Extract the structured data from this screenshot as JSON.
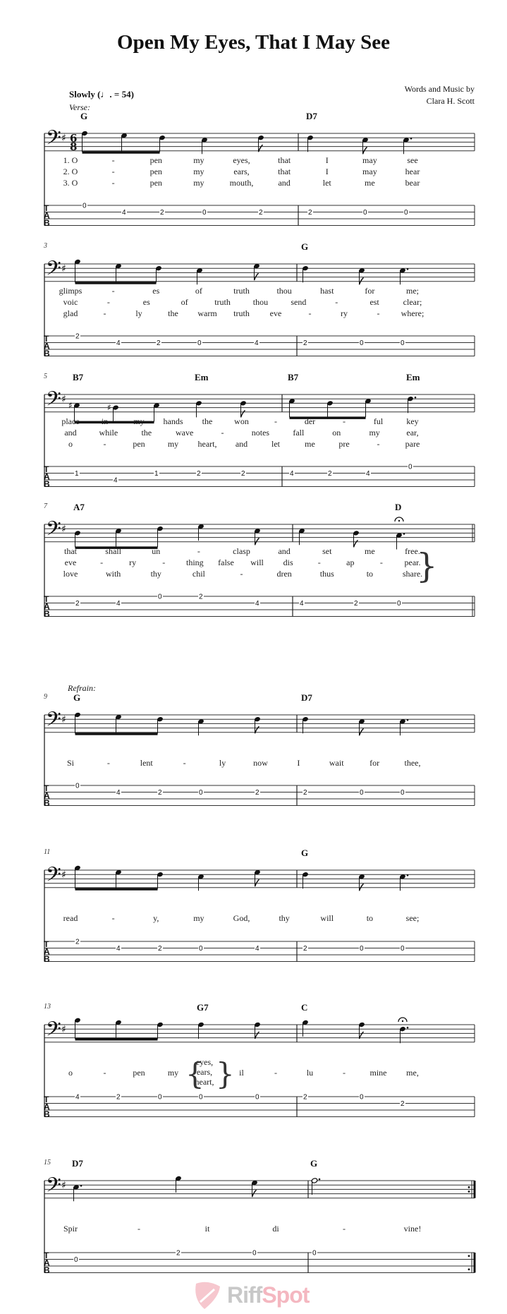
{
  "title": "Open My Eyes, That I May See",
  "tempo": {
    "text": "Slowly",
    "marking": "(♩. = 54)"
  },
  "credits": {
    "line1": "Words and Music by",
    "line2": "Clara H. Scott"
  },
  "section_labels": {
    "verse": "Verse:",
    "refrain": "Refrain:"
  },
  "time_signature": {
    "top": "6",
    "bottom": "8"
  },
  "key_signature": "G major (1 sharp)",
  "tab_label": [
    "T",
    "A",
    "B"
  ],
  "watermark": {
    "part1": "Riff",
    "part2": "Spot"
  },
  "systems": [
    {
      "measure_number": "",
      "chords": [
        {
          "label": "G",
          "beat": 0
        },
        {
          "label": "D7",
          "beat": 5
        }
      ],
      "notes": [
        {
          "p": 8,
          "dur": "8",
          "beam": "start"
        },
        {
          "p": 7,
          "dur": "8",
          "beam": "mid"
        },
        {
          "p": 6,
          "dur": "8",
          "beam": "end"
        },
        {
          "p": 5,
          "dur": "4"
        },
        {
          "p": 6,
          "dur": "8"
        },
        {
          "p": 6,
          "dur": "4",
          "bar_before": true
        },
        {
          "p": 5,
          "dur": "8"
        },
        {
          "p": 5,
          "dur": "4."
        }
      ],
      "tab": [
        {
          "s": 1,
          "f": "0"
        },
        {
          "s": 2,
          "f": "4"
        },
        {
          "s": 2,
          "f": "2"
        },
        {
          "s": 2,
          "f": "0"
        },
        {
          "s": 2,
          "f": "2"
        },
        {
          "s": 2,
          "f": "2"
        },
        {
          "s": 2,
          "f": "0"
        },
        {
          "s": 2,
          "f": "0"
        }
      ],
      "lyrics": [
        [
          "1. O",
          "-",
          "pen",
          "my",
          "eyes,",
          "that",
          "I",
          "may",
          "see"
        ],
        [
          "2. O",
          "-",
          "pen",
          "my",
          "ears,",
          "that",
          "I",
          "may",
          "hear"
        ],
        [
          "3. O",
          "-",
          "pen",
          "my",
          "mouth,",
          "and",
          "let",
          "me",
          "bear"
        ]
      ]
    },
    {
      "measure_number": "3",
      "chords": [
        {
          "label": "G",
          "beat": 5
        }
      ],
      "notes": [
        {
          "p": 9,
          "dur": "8",
          "beam": "start"
        },
        {
          "p": 7,
          "dur": "8",
          "beam": "mid"
        },
        {
          "p": 6,
          "dur": "8",
          "beam": "end"
        },
        {
          "p": 5,
          "dur": "4"
        },
        {
          "p": 7,
          "dur": "8"
        },
        {
          "p": 6,
          "dur": "4",
          "bar_before": true
        },
        {
          "p": 5,
          "dur": "8"
        },
        {
          "p": 5,
          "dur": "4."
        }
      ],
      "tab": [
        {
          "s": 1,
          "f": "2"
        },
        {
          "s": 2,
          "f": "4"
        },
        {
          "s": 2,
          "f": "2"
        },
        {
          "s": 2,
          "f": "0"
        },
        {
          "s": 2,
          "f": "4"
        },
        {
          "s": 2,
          "f": "2"
        },
        {
          "s": 2,
          "f": "0"
        },
        {
          "s": 2,
          "f": "0"
        }
      ],
      "lyrics": [
        [
          "glimps",
          "-",
          "es",
          "of",
          "truth",
          "thou",
          "hast",
          "for",
          "me;"
        ],
        [
          "voic",
          "-",
          "es",
          "of",
          "truth",
          "thou",
          "send",
          "-",
          "est",
          "clear;"
        ],
        [
          "glad",
          "-",
          "ly",
          "the",
          "warm",
          "truth",
          "eve",
          "-",
          "ry",
          "-",
          "where;"
        ]
      ]
    },
    {
      "measure_number": "5",
      "chords": [
        {
          "label": "B7",
          "beat": 0
        },
        {
          "label": "Em",
          "beat": 3
        },
        {
          "label": "B7",
          "beat": 5
        },
        {
          "label": "Em",
          "beat": 8
        }
      ],
      "notes": [
        {
          "p": 3,
          "dur": "8",
          "beam": "start",
          "acc": "#"
        },
        {
          "p": 2,
          "dur": "8",
          "beam": "mid",
          "acc": "#"
        },
        {
          "p": 3,
          "dur": "8",
          "beam": "end"
        },
        {
          "p": 4,
          "dur": "4"
        },
        {
          "p": 4,
          "dur": "8"
        },
        {
          "p": 5,
          "dur": "8",
          "beam": "start",
          "bar_before": true
        },
        {
          "p": 4,
          "dur": "8",
          "beam": "mid"
        },
        {
          "p": 5,
          "dur": "8",
          "beam": "end"
        },
        {
          "p": 6,
          "dur": "4."
        }
      ],
      "tab": [
        {
          "s": 2,
          "f": "1"
        },
        {
          "s": 3,
          "f": "4"
        },
        {
          "s": 2,
          "f": "1"
        },
        {
          "s": 2,
          "f": "2"
        },
        {
          "s": 2,
          "f": "2"
        },
        {
          "s": 2,
          "f": "4"
        },
        {
          "s": 2,
          "f": "2"
        },
        {
          "s": 2,
          "f": "4"
        },
        {
          "s": 1,
          "f": "0"
        }
      ],
      "lyrics": [
        [
          "place",
          "in",
          "my",
          "hands",
          "the",
          "won",
          "-",
          "der",
          "-",
          "ful",
          "key"
        ],
        [
          "and",
          "while",
          "the",
          "wave",
          "-",
          "notes",
          "fall",
          "on",
          "my",
          "ear,"
        ],
        [
          "o",
          "-",
          "pen",
          "my",
          "heart,",
          "and",
          "let",
          "me",
          "pre",
          "-",
          "pare"
        ]
      ]
    },
    {
      "measure_number": "7",
      "chords": [
        {
          "label": "A7",
          "beat": 0
        },
        {
          "label": "D",
          "beat": 7
        }
      ],
      "notes": [
        {
          "p": 4,
          "dur": "8",
          "beam": "start"
        },
        {
          "p": 5,
          "dur": "8",
          "beam": "mid"
        },
        {
          "p": 6,
          "dur": "8",
          "beam": "end"
        },
        {
          "p": 7,
          "dur": "4"
        },
        {
          "p": 5,
          "dur": "8"
        },
        {
          "p": 5,
          "dur": "4",
          "bar_before": true
        },
        {
          "p": 4,
          "dur": "8"
        },
        {
          "p": 3,
          "dur": "4.",
          "fermata": true
        }
      ],
      "tab": [
        {
          "s": 2,
          "f": "2"
        },
        {
          "s": 2,
          "f": "4"
        },
        {
          "s": 1,
          "f": "0"
        },
        {
          "s": 1,
          "f": "2"
        },
        {
          "s": 2,
          "f": "4"
        },
        {
          "s": 2,
          "f": "4"
        },
        {
          "s": 2,
          "f": "2"
        },
        {
          "s": 2,
          "f": "0"
        }
      ],
      "end_bar": "double",
      "lyrics": [
        [
          "that",
          "shall",
          "un",
          "-",
          "clasp",
          "and",
          "set",
          "me",
          "free."
        ],
        [
          "eve",
          "-",
          "ry",
          "-",
          "thing",
          "false",
          "will",
          "dis",
          "-",
          "ap",
          "-",
          "pear."
        ],
        [
          "love",
          "with",
          "thy",
          "chil",
          "-",
          "dren",
          "thus",
          "to",
          "share."
        ]
      ]
    },
    {
      "measure_number": "9",
      "chords": [
        {
          "label": "G",
          "beat": 0
        },
        {
          "label": "D7",
          "beat": 5
        }
      ],
      "notes": [
        {
          "p": 8,
          "dur": "8",
          "beam": "start"
        },
        {
          "p": 7,
          "dur": "8",
          "beam": "mid"
        },
        {
          "p": 6,
          "dur": "8",
          "beam": "end"
        },
        {
          "p": 5,
          "dur": "4"
        },
        {
          "p": 6,
          "dur": "8"
        },
        {
          "p": 6,
          "dur": "4",
          "bar_before": true
        },
        {
          "p": 5,
          "dur": "8"
        },
        {
          "p": 5,
          "dur": "4."
        }
      ],
      "tab": [
        {
          "s": 1,
          "f": "0"
        },
        {
          "s": 2,
          "f": "4"
        },
        {
          "s": 2,
          "f": "2"
        },
        {
          "s": 2,
          "f": "0"
        },
        {
          "s": 2,
          "f": "2"
        },
        {
          "s": 2,
          "f": "2"
        },
        {
          "s": 2,
          "f": "0"
        },
        {
          "s": 2,
          "f": "0"
        }
      ],
      "lyrics": [
        [
          "Si",
          "-",
          "lent",
          "-",
          "ly",
          "now",
          "I",
          "wait",
          "for",
          "thee,"
        ]
      ]
    },
    {
      "measure_number": "11",
      "chords": [
        {
          "label": "G",
          "beat": 5
        }
      ],
      "notes": [
        {
          "p": 9,
          "dur": "8",
          "beam": "start"
        },
        {
          "p": 7,
          "dur": "8",
          "beam": "mid"
        },
        {
          "p": 6,
          "dur": "8",
          "beam": "end"
        },
        {
          "p": 5,
          "dur": "4"
        },
        {
          "p": 7,
          "dur": "8"
        },
        {
          "p": 6,
          "dur": "4",
          "bar_before": true
        },
        {
          "p": 5,
          "dur": "8"
        },
        {
          "p": 5,
          "dur": "4."
        }
      ],
      "tab": [
        {
          "s": 1,
          "f": "2"
        },
        {
          "s": 2,
          "f": "4"
        },
        {
          "s": 2,
          "f": "2"
        },
        {
          "s": 2,
          "f": "0"
        },
        {
          "s": 2,
          "f": "4"
        },
        {
          "s": 2,
          "f": "2"
        },
        {
          "s": 2,
          "f": "0"
        },
        {
          "s": 2,
          "f": "0"
        }
      ],
      "lyrics": [
        [
          "read",
          "-",
          "y,",
          "my",
          "God,",
          "thy",
          "will",
          "to",
          "see;"
        ]
      ]
    },
    {
      "measure_number": "13",
      "chords": [
        {
          "label": "G7",
          "beat": 3
        },
        {
          "label": "C",
          "beat": 5
        }
      ],
      "notes": [
        {
          "p": 10,
          "dur": "8",
          "beam": "start"
        },
        {
          "p": 9,
          "dur": "8",
          "beam": "mid"
        },
        {
          "p": 8,
          "dur": "8",
          "beam": "end"
        },
        {
          "p": 8,
          "dur": "4"
        },
        {
          "p": 8,
          "dur": "8"
        },
        {
          "p": 9,
          "dur": "4",
          "bar_before": true
        },
        {
          "p": 8,
          "dur": "8"
        },
        {
          "p": 6,
          "dur": "4.",
          "fermata": true
        }
      ],
      "tab": [
        {
          "s": 1,
          "f": "4"
        },
        {
          "s": 1,
          "f": "2"
        },
        {
          "s": 1,
          "f": "0"
        },
        {
          "s": 1,
          "f": "0"
        },
        {
          "s": 1,
          "f": "0"
        },
        {
          "s": 1,
          "f": "2"
        },
        {
          "s": 1,
          "f": "0"
        },
        {
          "s": 2,
          "f": "2"
        }
      ],
      "lyrics": [
        [
          "o",
          "-",
          "pen",
          "my",
          "",
          "il",
          "-",
          "lu",
          "-",
          "mine",
          "me,"
        ]
      ],
      "lyric_stack": [
        "eyes,",
        "ears,",
        "heart,"
      ]
    },
    {
      "measure_number": "15",
      "chords": [
        {
          "label": "D7",
          "beat": 0
        },
        {
          "label": "G",
          "beat": 5
        }
      ],
      "notes": [
        {
          "p": 5,
          "dur": "4."
        },
        {
          "p": 9,
          "dur": "4"
        },
        {
          "p": 7,
          "dur": "8"
        },
        {
          "p": 8,
          "dur": "2.",
          "bar_before": true
        }
      ],
      "tab": [
        {
          "s": 2,
          "f": "0"
        },
        {
          "s": 1,
          "f": "2"
        },
        {
          "s": 1,
          "f": "0"
        },
        {
          "s": 1,
          "f": "0"
        }
      ],
      "end_bar": "repeat",
      "lyrics": [
        [
          "Spir",
          "-",
          "it",
          "di",
          "-",
          "vine!"
        ]
      ]
    }
  ]
}
